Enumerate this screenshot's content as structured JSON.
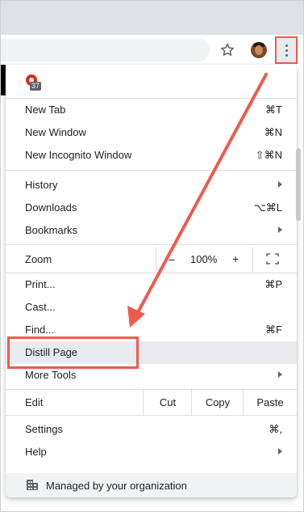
{
  "extension": {
    "badge": "37"
  },
  "menu": {
    "new_tab": {
      "label": "New Tab",
      "shortcut": "⌘T"
    },
    "new_window": {
      "label": "New Window",
      "shortcut": "⌘N"
    },
    "new_incognito": {
      "label": "New Incognito Window",
      "shortcut": "⇧⌘N"
    },
    "history": {
      "label": "History"
    },
    "downloads": {
      "label": "Downloads",
      "shortcut": "⌥⌘L"
    },
    "bookmarks": {
      "label": "Bookmarks"
    },
    "zoom": {
      "label": "Zoom",
      "minus": "–",
      "value": "100%",
      "plus": "+"
    },
    "print": {
      "label": "Print...",
      "shortcut": "⌘P"
    },
    "cast": {
      "label": "Cast..."
    },
    "find": {
      "label": "Find...",
      "shortcut": "⌘F"
    },
    "distill": {
      "label": "Distill Page"
    },
    "more_tools": {
      "label": "More Tools"
    },
    "edit": {
      "label": "Edit",
      "cut": "Cut",
      "copy": "Copy",
      "paste": "Paste"
    },
    "settings": {
      "label": "Settings",
      "shortcut": "⌘,"
    },
    "help": {
      "label": "Help"
    },
    "managed": {
      "label": "Managed by your organization"
    }
  },
  "colors": {
    "annotation": "#ef5a4e",
    "hover": "#e8eaed",
    "separator": "#dadce0"
  }
}
